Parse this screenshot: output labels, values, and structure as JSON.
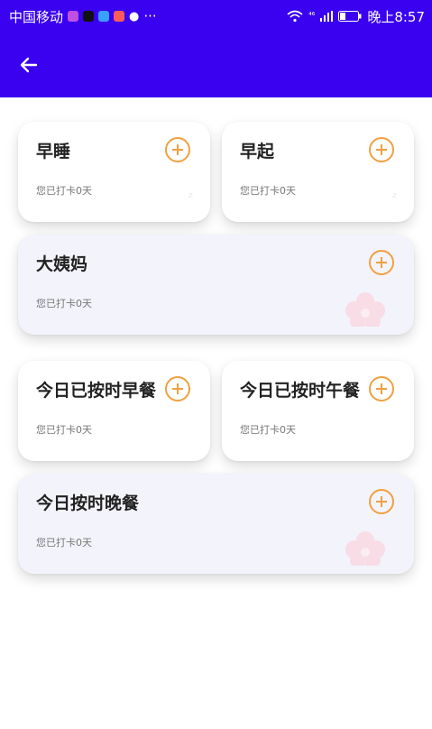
{
  "status_bar": {
    "carrier": "中国移动",
    "more": "···",
    "network": "⁴⁶",
    "time": "晚上8:57"
  },
  "cards": [
    {
      "title": "早睡",
      "subtitle": "您已打卡0天",
      "deco_icon": "moon-icon"
    },
    {
      "title": "早起",
      "subtitle": "您已打卡0天",
      "deco_icon": "moon-icon"
    },
    {
      "title": "大姨妈",
      "subtitle": "您已打卡0天",
      "deco_icon": "flower-icon"
    },
    {
      "title": "今日已按时早餐",
      "subtitle": "您已打卡0天",
      "deco_icon": "moon-icon"
    },
    {
      "title": "今日已按时午餐",
      "subtitle": "您已打卡0天",
      "deco_icon": "moon-icon"
    },
    {
      "title": "今日按时晚餐",
      "subtitle": "您已打卡0天",
      "deco_icon": "flower-icon"
    }
  ],
  "colors": {
    "header": "#3a00f0",
    "accent": "#f0a040",
    "card_tint": "#f3f3fb"
  }
}
